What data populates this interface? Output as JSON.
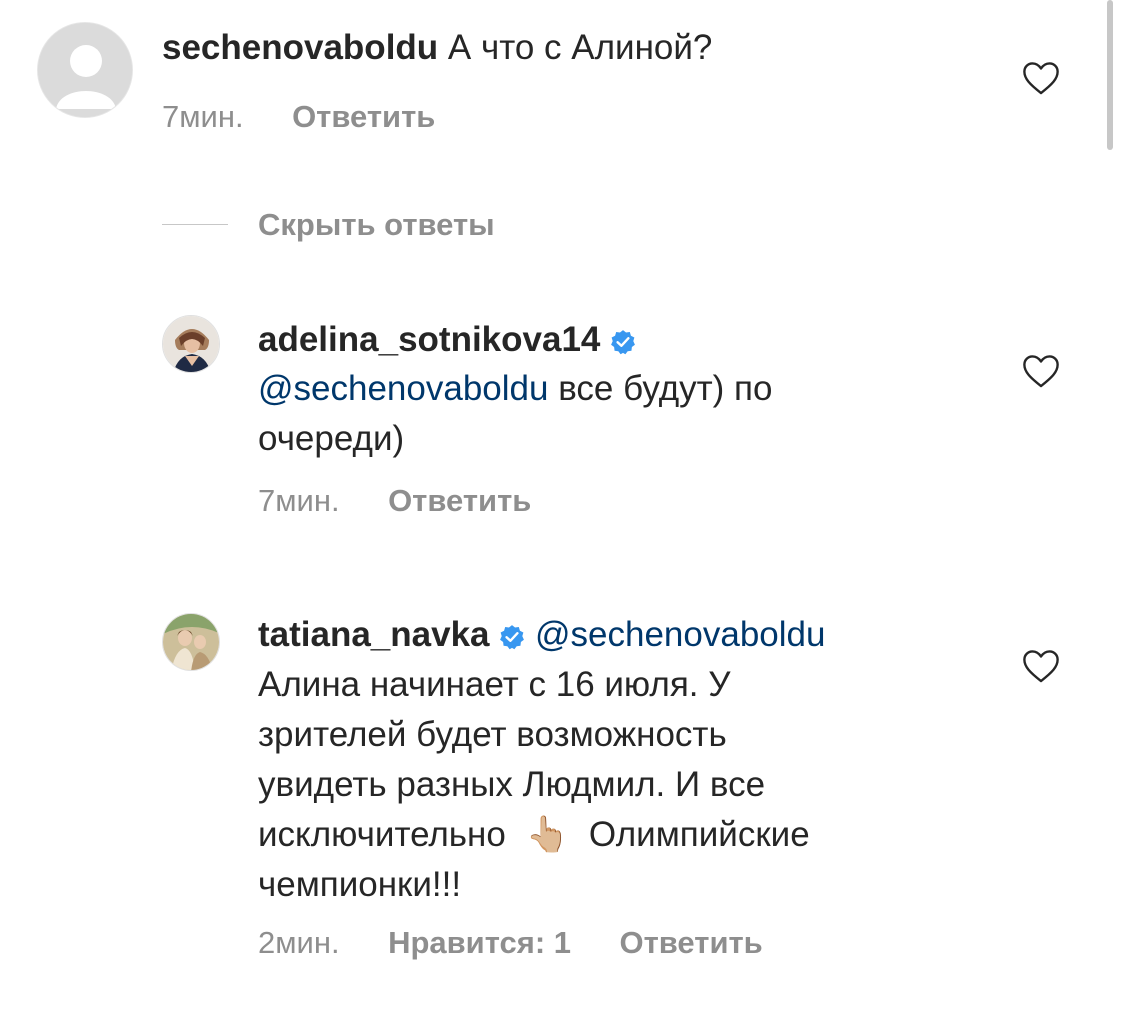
{
  "colors": {
    "text": "#262626",
    "meta": "#8e8e8e",
    "mention": "#00376b",
    "verified": "#3897f0"
  },
  "comments": [
    {
      "username": "sechenovaboldu",
      "text": "А что с Алиной?",
      "time": "7мин.",
      "reply": "Ответить"
    }
  ],
  "hide_replies": "Скрыть ответы",
  "replies": [
    {
      "username": "adelina_sotnikova14",
      "mention": "@sechenovaboldu",
      "text_1": " все будут) по",
      "text_2": "очереди)",
      "time": "7мин.",
      "reply": "Ответить"
    },
    {
      "username": "tatiana_navka",
      "mention": "@sechenovaboldu",
      "line_1": "Алина начинает с 16 июля. У",
      "line_2": "зрителей будет возможность",
      "line_3": "увидеть разных Людмил. И все",
      "line_4a": "исключительно",
      "emoji": "👆🏼",
      "line_4b": "Олимпийские",
      "line_5": "чемпионки!!!",
      "time": "2мин.",
      "likes": "Нравится: 1",
      "reply": "Ответить"
    }
  ]
}
